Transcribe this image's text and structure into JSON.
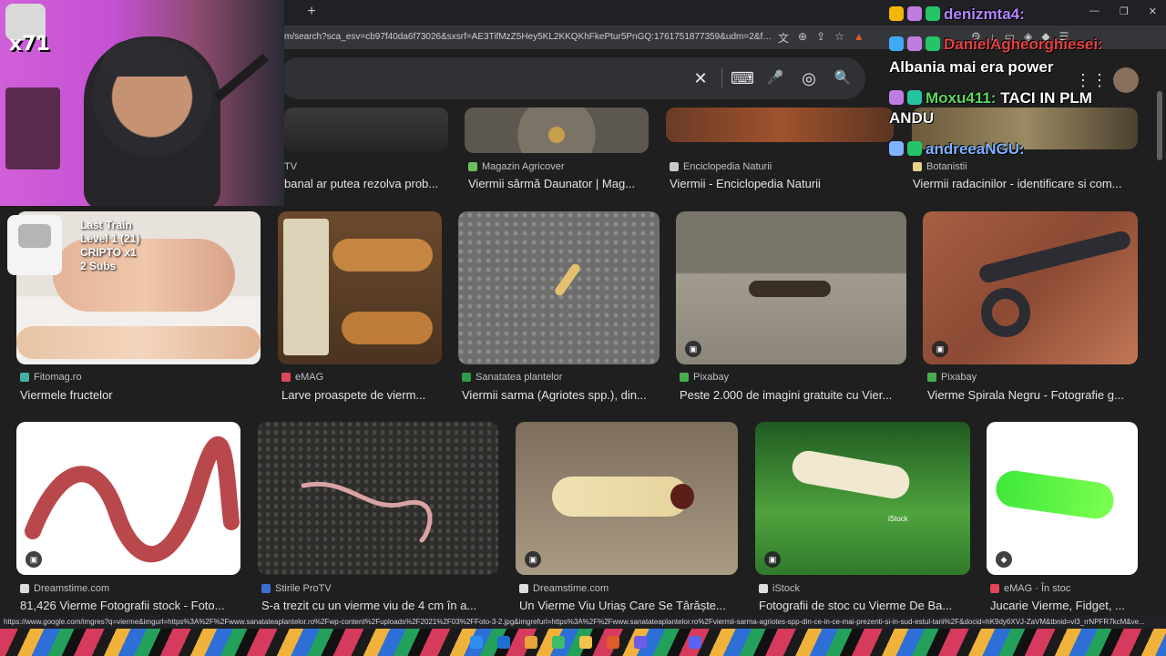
{
  "browser": {
    "new_tab": "+",
    "url": "m/search?sca_esv=cb97f40da6f73026&sxsrf=AE3TifMzZ5Hey5KL2KKQKhFkePtur5PnGQ:1761751877359&udm=2&fbs=AIljpHx...",
    "window_controls": [
      "—",
      "❐",
      "✕"
    ],
    "status_url": "https://www.google.com/imgres?q=vierme&imgurl=https%3A%2F%2Fwww.sanatateaplantelor.ro%2Fwp-content%2Fuploads%2F2021%2F03%2FFoto-3-2.jpg&imgrefurl=https%3A%2F%2Fwww.sanatateaplantelor.ro%2Fviermii-sarma-agriotes-spp-din-ce-in-ce-mai-prezenti-si-in-sud-estul-tarii%2F&docid=hK9dy6XVJ-ZaVM&tbnid=vl3_rrNPFR7kcM&ve..."
  },
  "search": {
    "value": "",
    "clear_icon": "✕",
    "keyboard_icon": "⌨",
    "mic_icon": "🎤",
    "lens_icon": "◎",
    "search_icon": "🔍"
  },
  "row1": [
    {
      "source": "TV",
      "title": "banal ar putea rezolva prob...",
      "color": "#888888"
    },
    {
      "source": "Magazin Agricover",
      "title": "Viermii sârmă Daunator | Mag...",
      "color": "#6bbf59"
    },
    {
      "source": "Enciclopedia Naturii",
      "title": "Viermii - Enciclopedia Naturii",
      "color": "#c9c9c9"
    },
    {
      "source": "Botanistii",
      "title": "Viermii radacinilor - identificare si com...",
      "color": "#e6d28a"
    }
  ],
  "row2": [
    {
      "source": "Fitomag.ro",
      "title": "Viermele fructelor",
      "color": "#46b0a8"
    },
    {
      "source": "eMAG",
      "title": "Larve proaspete de vierm...",
      "color": "#e0455a"
    },
    {
      "source": "Sanatatea plantelor",
      "title": "Viermii sarma (Agriotes spp.), din...",
      "color": "#2f9a4a"
    },
    {
      "source": "Pixabay",
      "title": "Peste 2.000 de imagini gratuite cu Vier...",
      "color": "#47b04b"
    },
    {
      "source": "Pixabay",
      "title": "Vierme Spirala Negru - Fotografie g...",
      "color": "#47b04b"
    }
  ],
  "row3": [
    {
      "source": "Dreamstime.com",
      "title": "81,426 Vierme Fotografii stock - Foto...",
      "color": "#dddddd"
    },
    {
      "source": "Stirile ProTV",
      "title": "S-a trezit cu un vierme viu de 4 cm în a...",
      "color": "#3b6fd6"
    },
    {
      "source": "Dreamstime.com",
      "title": "Un Vierme Viu Uriaș Care Se Târăște...",
      "color": "#dddddd"
    },
    {
      "source": "iStock",
      "title": "Fotografii de stoc cu Vierme De Ba...",
      "color": "#dddddd"
    },
    {
      "source": "eMAG · În stoc",
      "title": "Jucarie Vierme, Fidget, ...",
      "color": "#e0455a"
    }
  ],
  "overlay": {
    "combo": "x71",
    "train": [
      "Last Train",
      "Level 1  (21)",
      "CRIPTO x1",
      "2 Subs"
    ]
  },
  "chat": [
    {
      "name": "denizmta4:",
      "message": ""
    },
    {
      "name": "DanielAgheorghiesei:",
      "message": ""
    },
    {
      "name": "",
      "message": "Albania mai era power"
    },
    {
      "name": "Moxu411:",
      "message": "TACI IN PLM"
    },
    {
      "name": "",
      "message": "ANDU"
    },
    {
      "name": "andreeaNGU:",
      "message": ""
    }
  ]
}
